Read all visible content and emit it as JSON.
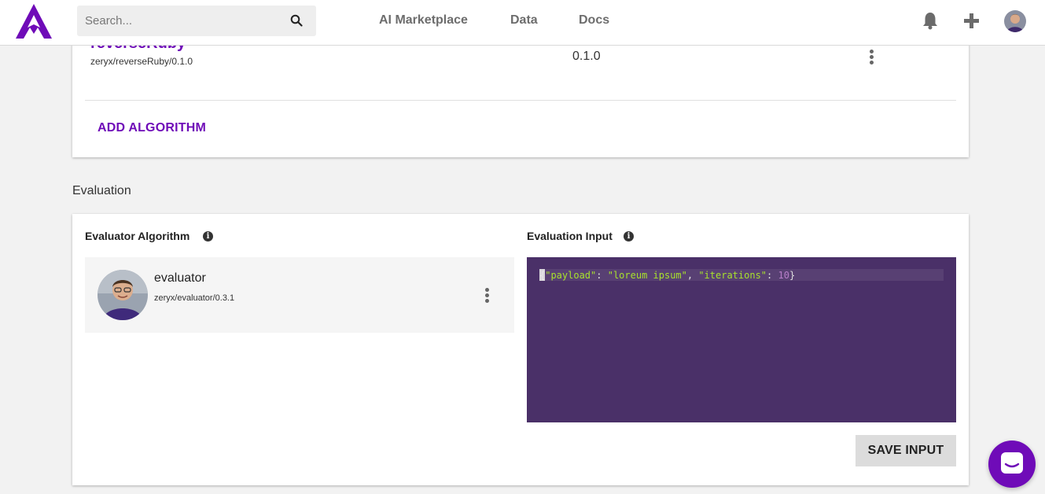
{
  "header": {
    "search_placeholder": "Search...",
    "nav": [
      "AI Marketplace",
      "Data",
      "Docs"
    ],
    "icons": [
      "logo-icon",
      "search-icon",
      "bell-icon",
      "plus-icon",
      "user-avatar"
    ]
  },
  "algorithms": {
    "items": [
      {
        "name": "reverseRuby",
        "path": "zeryx/reverseRuby/0.1.0",
        "version": "0.1.0"
      }
    ],
    "add_label": "ADD ALGORITHM"
  },
  "evaluation": {
    "section_label": "Evaluation",
    "evaluator_title": "Evaluator Algorithm",
    "input_title": "Evaluation Input",
    "evaluator": {
      "name": "evaluator",
      "path": "zeryx/evaluator/0.3.1"
    },
    "input_code": {
      "key1": "\"payload\"",
      "val1": "\"loreum ipsum\"",
      "key2": "\"iterations\"",
      "val2": "10"
    },
    "save_label": "SAVE INPUT"
  },
  "colors": {
    "brand": "#6f0bb8",
    "editor_bg": "#4a3068",
    "string": "#a8e22c",
    "number": "#b77ec9"
  }
}
